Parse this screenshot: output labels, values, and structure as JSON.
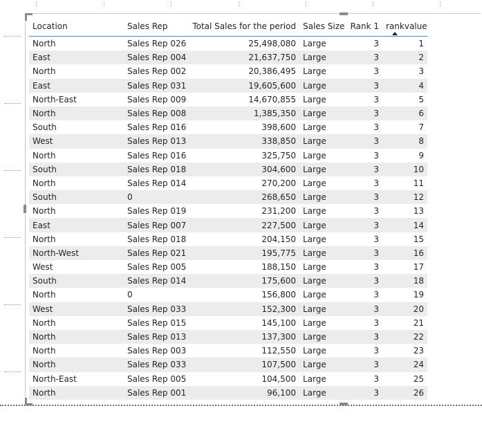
{
  "table": {
    "columns": {
      "location": "Location",
      "sales_rep": "Sales Rep",
      "total_sales": "Total Sales for the period",
      "sales_size": "Sales Size",
      "rank1": "Rank 1",
      "rankvalue": "rankvalue"
    },
    "sort_column": "rankvalue",
    "sort_direction": "ascending",
    "rows": [
      {
        "location": "North",
        "sales_rep": "Sales Rep 026",
        "total_sales": "25,498,080",
        "sales_size": "Large",
        "rank1": "3",
        "rankvalue": "1"
      },
      {
        "location": "East",
        "sales_rep": "Sales Rep 004",
        "total_sales": "21,637,750",
        "sales_size": "Large",
        "rank1": "3",
        "rankvalue": "2"
      },
      {
        "location": "North",
        "sales_rep": "Sales Rep 002",
        "total_sales": "20,386,495",
        "sales_size": "Large",
        "rank1": "3",
        "rankvalue": "3"
      },
      {
        "location": "East",
        "sales_rep": "Sales Rep 031",
        "total_sales": "19,605,600",
        "sales_size": "Large",
        "rank1": "3",
        "rankvalue": "4"
      },
      {
        "location": "North-East",
        "sales_rep": "Sales Rep 009",
        "total_sales": "14,670,855",
        "sales_size": "Large",
        "rank1": "3",
        "rankvalue": "5"
      },
      {
        "location": "North",
        "sales_rep": "Sales Rep 008",
        "total_sales": "1,385,350",
        "sales_size": "Large",
        "rank1": "3",
        "rankvalue": "6"
      },
      {
        "location": "South",
        "sales_rep": "Sales Rep 016",
        "total_sales": "398,600",
        "sales_size": "Large",
        "rank1": "3",
        "rankvalue": "7"
      },
      {
        "location": "West",
        "sales_rep": "Sales Rep 013",
        "total_sales": "338,850",
        "sales_size": "Large",
        "rank1": "3",
        "rankvalue": "8"
      },
      {
        "location": "North",
        "sales_rep": "Sales Rep 016",
        "total_sales": "325,750",
        "sales_size": "Large",
        "rank1": "3",
        "rankvalue": "9"
      },
      {
        "location": "South",
        "sales_rep": "Sales Rep 018",
        "total_sales": "304,600",
        "sales_size": "Large",
        "rank1": "3",
        "rankvalue": "10"
      },
      {
        "location": "North",
        "sales_rep": "Sales Rep 014",
        "total_sales": "270,200",
        "sales_size": "Large",
        "rank1": "3",
        "rankvalue": "11"
      },
      {
        "location": "South",
        "sales_rep": "0",
        "total_sales": "268,650",
        "sales_size": "Large",
        "rank1": "3",
        "rankvalue": "12"
      },
      {
        "location": "North",
        "sales_rep": "Sales Rep 019",
        "total_sales": "231,200",
        "sales_size": "Large",
        "rank1": "3",
        "rankvalue": "13"
      },
      {
        "location": "East",
        "sales_rep": "Sales Rep 007",
        "total_sales": "227,500",
        "sales_size": "Large",
        "rank1": "3",
        "rankvalue": "14"
      },
      {
        "location": "North",
        "sales_rep": "Sales Rep 018",
        "total_sales": "204,150",
        "sales_size": "Large",
        "rank1": "3",
        "rankvalue": "15"
      },
      {
        "location": "North-West",
        "sales_rep": "Sales Rep 021",
        "total_sales": "195,775",
        "sales_size": "Large",
        "rank1": "3",
        "rankvalue": "16"
      },
      {
        "location": "West",
        "sales_rep": "Sales Rep 005",
        "total_sales": "188,150",
        "sales_size": "Large",
        "rank1": "3",
        "rankvalue": "17"
      },
      {
        "location": "South",
        "sales_rep": "Sales Rep 014",
        "total_sales": "175,600",
        "sales_size": "Large",
        "rank1": "3",
        "rankvalue": "18"
      },
      {
        "location": "North",
        "sales_rep": "0",
        "total_sales": "156,800",
        "sales_size": "Large",
        "rank1": "3",
        "rankvalue": "19"
      },
      {
        "location": "West",
        "sales_rep": "Sales Rep 033",
        "total_sales": "152,300",
        "sales_size": "Large",
        "rank1": "3",
        "rankvalue": "20"
      },
      {
        "location": "North",
        "sales_rep": "Sales Rep 015",
        "total_sales": "145,100",
        "sales_size": "Large",
        "rank1": "3",
        "rankvalue": "21"
      },
      {
        "location": "North",
        "sales_rep": "Sales Rep 013",
        "total_sales": "137,300",
        "sales_size": "Large",
        "rank1": "3",
        "rankvalue": "22"
      },
      {
        "location": "North",
        "sales_rep": "Sales Rep 003",
        "total_sales": "112,550",
        "sales_size": "Large",
        "rank1": "3",
        "rankvalue": "23"
      },
      {
        "location": "North",
        "sales_rep": "Sales Rep 033",
        "total_sales": "107,500",
        "sales_size": "Large",
        "rank1": "3",
        "rankvalue": "24"
      },
      {
        "location": "North-East",
        "sales_rep": "Sales Rep 005",
        "total_sales": "104,500",
        "sales_size": "Large",
        "rank1": "3",
        "rankvalue": "25"
      },
      {
        "location": "North",
        "sales_rep": "Sales Rep 001",
        "total_sales": "96,100",
        "sales_size": "Large",
        "rank1": "3",
        "rankvalue": "26"
      }
    ]
  },
  "colors": {
    "header_underline": "#3a8fd6",
    "banded_row": "#ececec",
    "text": "#252423"
  },
  "icons": {
    "sort": "sort-ascending-icon"
  }
}
